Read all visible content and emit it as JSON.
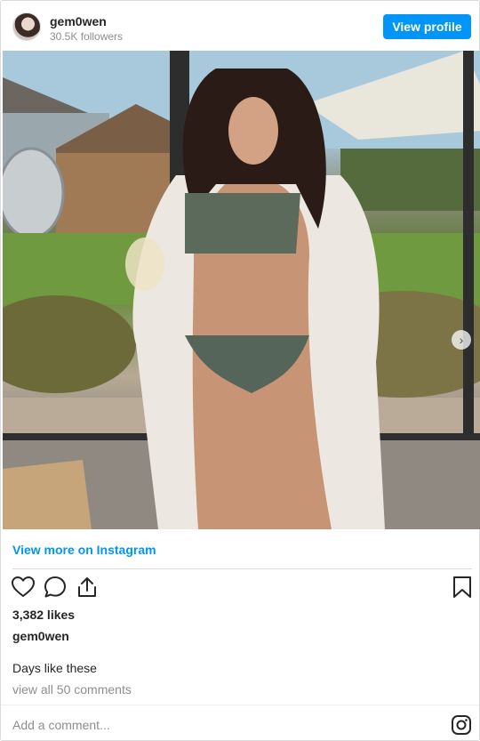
{
  "header": {
    "username": "gem0wen",
    "followers": "30.5K followers",
    "view_profile_label": "View profile"
  },
  "media": {
    "image_icon": "photo-image",
    "next_icon": "chevron-right-icon",
    "carousel": {
      "count": 2,
      "active": 1
    }
  },
  "link": {
    "view_more_label": "View more on Instagram"
  },
  "actions": {
    "like_icon": "heart-icon",
    "comment_icon": "comment-icon",
    "share_icon": "share-icon",
    "save_icon": "bookmark-icon"
  },
  "post": {
    "likes": "3,382 likes",
    "caption_user": "gem0wen",
    "caption": "Days like these",
    "view_comments": "view all 50 comments"
  },
  "comment_box": {
    "placeholder": "Add a comment...",
    "instagram_icon": "instagram-logo-icon"
  },
  "colors": {
    "accent": "#0095f6",
    "text": "#262626",
    "muted": "#8e8e8e",
    "border": "#dbdbdb"
  }
}
